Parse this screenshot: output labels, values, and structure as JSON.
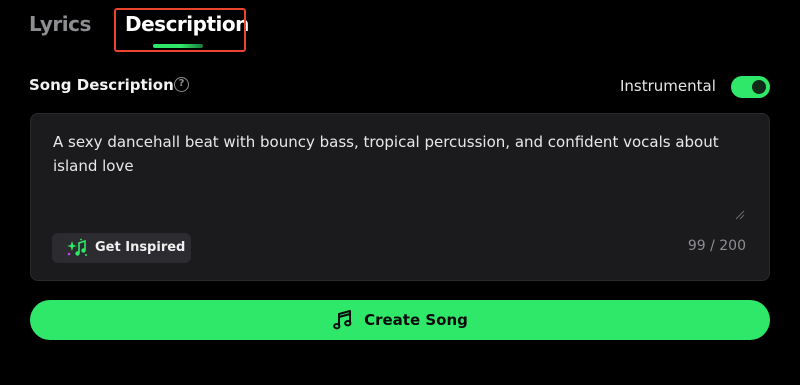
{
  "tabs": {
    "lyrics": "Lyrics",
    "description": "Description"
  },
  "section": {
    "label": "Song Description",
    "help_icon": "question-circle-icon",
    "help_glyph": "?"
  },
  "instrumental": {
    "label": "Instrumental",
    "on": true
  },
  "description": {
    "text": "A sexy dancehall beat with bouncy bass, tropical percussion, and confident vocals about island love",
    "char_count": "99 / 200"
  },
  "inspired_button": {
    "label": "Get Inspired",
    "icon": "sparkle-note-icon"
  },
  "create_button": {
    "label": "Create Song",
    "icon": "music-notes-icon"
  },
  "colors": {
    "accent": "#2fe86a",
    "background": "#000000",
    "card": "#1b1b1d",
    "highlight": "#e8452c",
    "muted": "#8d8d92"
  }
}
